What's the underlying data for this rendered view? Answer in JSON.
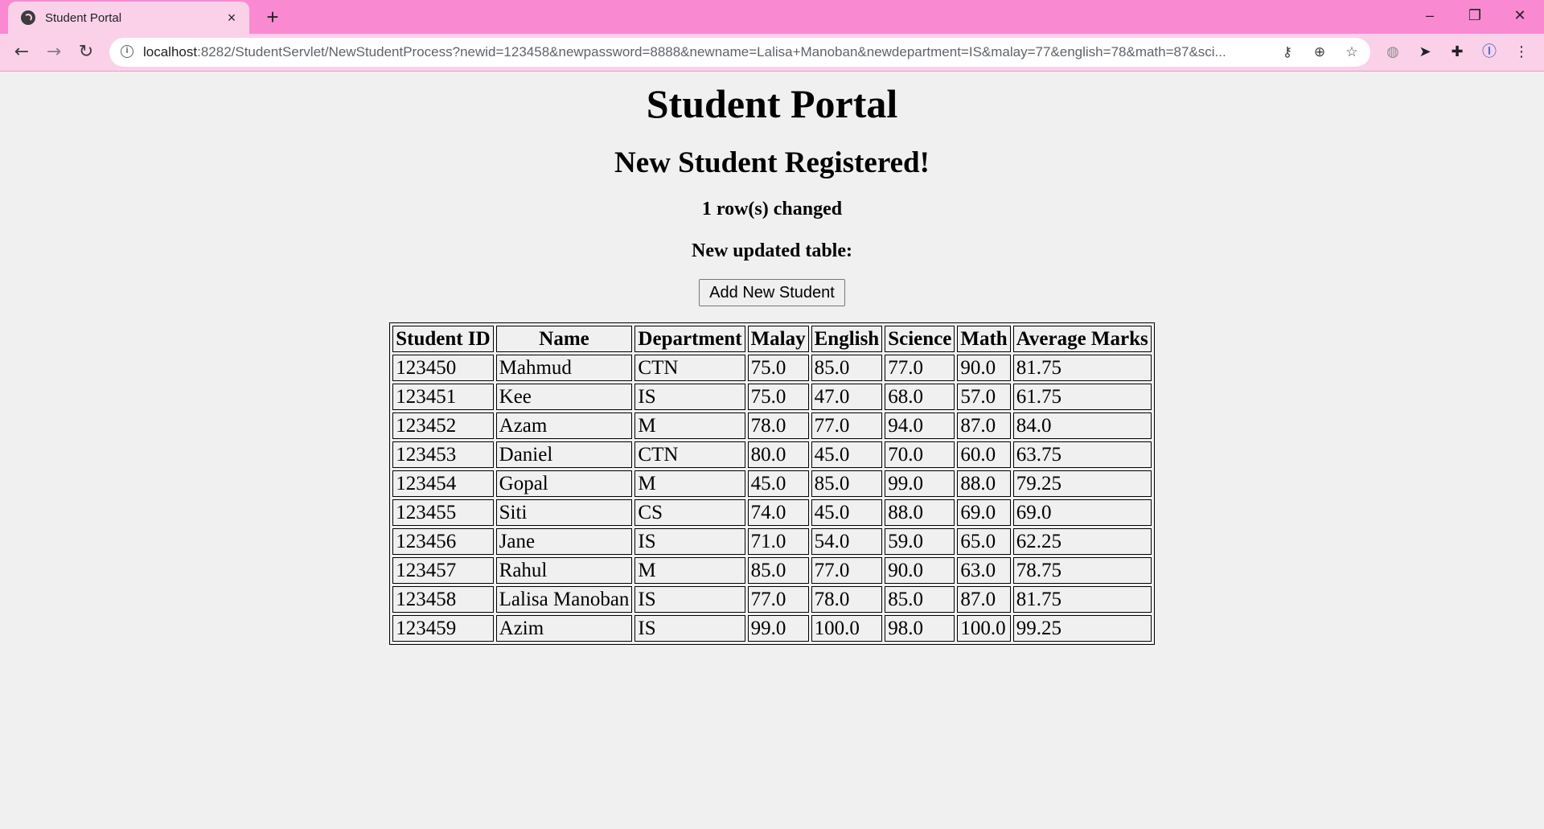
{
  "browser": {
    "tab_title": "Student Portal",
    "tab_close": "×",
    "new_tab": "+",
    "url_host": "localhost",
    "url_rest": ":8282/StudentServlet/NewStudentProcess?newid=123458&newpassword=8888&newname=Lalisa+Manoban&newdepartment=IS&malay=77&english=78&math=87&sci...",
    "controls": {
      "minimize": "–",
      "maximize": "❐",
      "close": "✕"
    },
    "nav": {
      "back": "←",
      "forward": "→",
      "reload": "↻"
    },
    "omnibox_icons": {
      "key": "⚷",
      "zoom": "⊕",
      "star": "☆"
    },
    "extension_icons": {
      "ext1": "◍",
      "ext2": "➤",
      "puzzle": "✚",
      "profile": "Ⓘ",
      "menu": "⋮"
    },
    "accent_color": "#f98ad1"
  },
  "page": {
    "title": "Student Portal",
    "subtitle": "New Student Registered!",
    "rows_changed": "1 row(s) changed",
    "table_caption": "New updated table:",
    "add_button_label": "Add New Student"
  },
  "table": {
    "headers": [
      "Student ID",
      "Name",
      "Department",
      "Malay",
      "English",
      "Science",
      "Math",
      "Average Marks"
    ],
    "rows": [
      [
        "123450",
        "Mahmud",
        "CTN",
        "75.0",
        "85.0",
        "77.0",
        "90.0",
        "81.75"
      ],
      [
        "123451",
        "Kee",
        "IS",
        "75.0",
        "47.0",
        "68.0",
        "57.0",
        "61.75"
      ],
      [
        "123452",
        "Azam",
        "M",
        "78.0",
        "77.0",
        "94.0",
        "87.0",
        "84.0"
      ],
      [
        "123453",
        "Daniel",
        "CTN",
        "80.0",
        "45.0",
        "70.0",
        "60.0",
        "63.75"
      ],
      [
        "123454",
        "Gopal",
        "M",
        "45.0",
        "85.0",
        "99.0",
        "88.0",
        "79.25"
      ],
      [
        "123455",
        "Siti",
        "CS",
        "74.0",
        "45.0",
        "88.0",
        "69.0",
        "69.0"
      ],
      [
        "123456",
        "Jane",
        "IS",
        "71.0",
        "54.0",
        "59.0",
        "65.0",
        "62.25"
      ],
      [
        "123457",
        "Rahul",
        "M",
        "85.0",
        "77.0",
        "90.0",
        "63.0",
        "78.75"
      ],
      [
        "123458",
        "Lalisa Manoban",
        "IS",
        "77.0",
        "78.0",
        "85.0",
        "87.0",
        "81.75"
      ],
      [
        "123459",
        "Azim",
        "IS",
        "99.0",
        "100.0",
        "98.0",
        "100.0",
        "99.25"
      ]
    ]
  }
}
